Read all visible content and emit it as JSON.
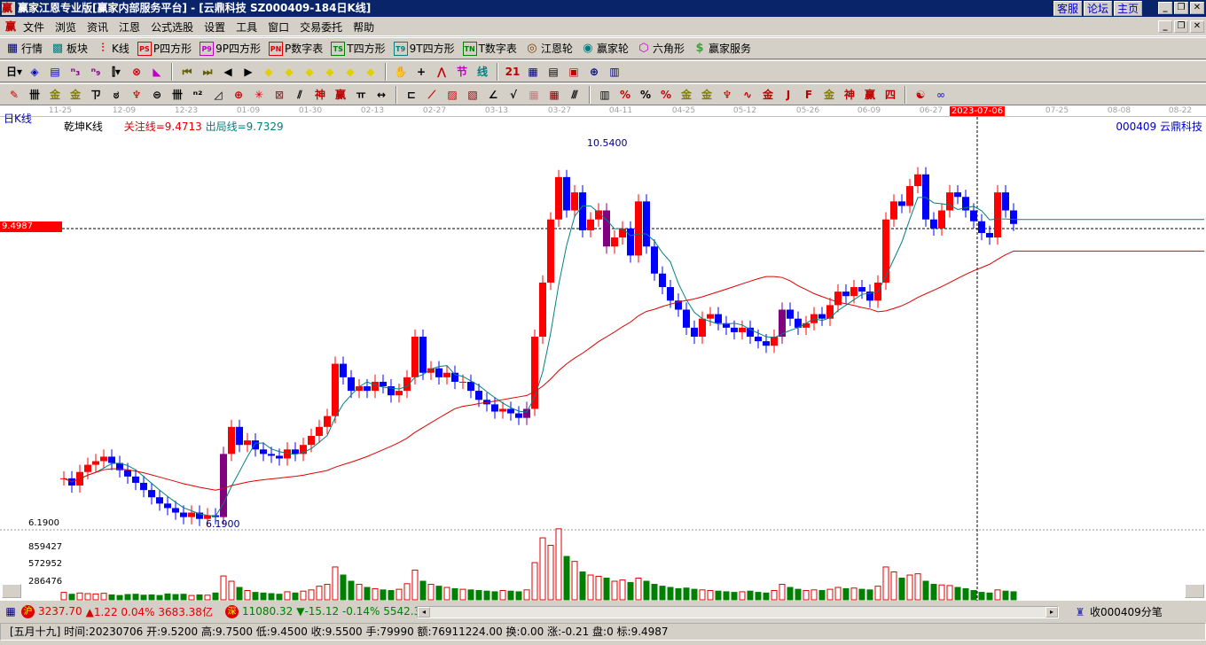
{
  "window": {
    "title": "赢家江恩专业版[赢家内部服务平台] - [云鼎科技   SZ000409-184日K线]",
    "links": [
      "客服",
      "论坛",
      "主页"
    ]
  },
  "menu": [
    "文件",
    "浏览",
    "资讯",
    "江恩",
    "公式选股",
    "设置",
    "工具",
    "窗口",
    "交易委托",
    "帮助"
  ],
  "toolbar1": [
    {
      "icon": "table-icon",
      "glyph": "▦",
      "color": "#000080",
      "label": "行情"
    },
    {
      "icon": "blocks-icon",
      "glyph": "▩",
      "color": "#008080",
      "label": "板块"
    },
    {
      "icon": "kline-icon",
      "glyph": "⫶",
      "color": "#e00000",
      "label": "K线"
    },
    {
      "icon": "ps-icon",
      "glyph": "PS",
      "color": "#e00000",
      "label": "P四方形"
    },
    {
      "icon": "p9-icon",
      "glyph": "P9",
      "color": "#c000c0",
      "label": "9P四方形"
    },
    {
      "icon": "pn-icon",
      "glyph": "PN",
      "color": "#e00000",
      "label": "P数字表"
    },
    {
      "icon": "ts-icon",
      "glyph": "TS",
      "color": "#008000",
      "label": "T四方形"
    },
    {
      "icon": "t9-icon",
      "glyph": "T9",
      "color": "#008080",
      "label": "9T四方形"
    },
    {
      "icon": "tn-icon",
      "glyph": "TN",
      "color": "#008000",
      "label": "T数字表"
    },
    {
      "icon": "gann-wheel-icon",
      "glyph": "◎",
      "color": "#804000",
      "label": "江恩轮"
    },
    {
      "icon": "winner-wheel-icon",
      "glyph": "◉",
      "color": "#008080",
      "label": "赢家轮"
    },
    {
      "icon": "hexagon-icon",
      "glyph": "⬡",
      "color": "#c000c0",
      "label": "六角形"
    },
    {
      "icon": "dollar-icon",
      "glyph": "$",
      "color": "#40a040",
      "label": "赢家服务"
    }
  ],
  "toolbar2": [
    {
      "n": "period-day",
      "g": "日▾",
      "c": "#000"
    },
    {
      "n": "chart-style",
      "g": "◈",
      "c": "#0000c0"
    },
    {
      "n": "notes",
      "g": "▤",
      "c": "#0000c0"
    },
    {
      "n": "indicator-3",
      "g": "ⁿ₃",
      "c": "#800080"
    },
    {
      "n": "indicator-9",
      "g": "ⁿ₉",
      "c": "#800080"
    },
    {
      "n": "candle-type",
      "g": "⫿▾",
      "c": "#000"
    },
    {
      "n": "restore",
      "g": "⊗",
      "c": "#c00000"
    },
    {
      "n": "flag",
      "g": "◣",
      "c": "#c000c0"
    },
    {
      "n": "first",
      "g": "⏮",
      "c": "#606000"
    },
    {
      "n": "last",
      "g": "⏭",
      "c": "#606000"
    },
    {
      "n": "prev",
      "g": "◀",
      "c": "#000"
    },
    {
      "n": "next",
      "g": "▶",
      "c": "#000"
    },
    {
      "n": "diamond-left",
      "g": "◆",
      "c": "#e0d000"
    },
    {
      "n": "diamond-right",
      "g": "◆",
      "c": "#e0d000"
    },
    {
      "n": "diamond-h",
      "g": "◆",
      "c": "#e0d000"
    },
    {
      "n": "diamond-x",
      "g": "◆",
      "c": "#e0d000"
    },
    {
      "n": "diamond-star",
      "g": "◆",
      "c": "#e0d000"
    },
    {
      "n": "diamond-cross",
      "g": "◆",
      "c": "#e0d000"
    },
    {
      "n": "hand",
      "g": "✋",
      "c": "#000"
    },
    {
      "n": "crosshair",
      "g": "+",
      "c": "#000"
    },
    {
      "n": "zigzag",
      "g": "⋀",
      "c": "#c00000"
    },
    {
      "n": "section",
      "g": "节",
      "c": "#c000c0"
    },
    {
      "n": "line-draw",
      "g": "线",
      "c": "#008080"
    },
    {
      "n": "calendar",
      "g": "21",
      "c": "#c00000"
    },
    {
      "n": "calculator",
      "g": "▦",
      "c": "#000080"
    },
    {
      "n": "report",
      "g": "▤",
      "c": "#000"
    },
    {
      "n": "save",
      "g": "▣",
      "c": "#c00000"
    },
    {
      "n": "network",
      "g": "⊕",
      "c": "#000080"
    },
    {
      "n": "print",
      "g": "▥",
      "c": "#000080"
    }
  ],
  "toolbar3": [
    {
      "n": "pen",
      "g": "✎",
      "c": "#c00000"
    },
    {
      "n": "grid-lines",
      "g": "卌",
      "c": "#000"
    },
    {
      "n": "gold-1",
      "g": "金",
      "c": "#808000"
    },
    {
      "n": "gold-2",
      "g": "金",
      "c": "#808000"
    },
    {
      "n": "f-lines",
      "g": "ㄗ",
      "c": "#000"
    },
    {
      "n": "spiral",
      "g": "ಠ",
      "c": "#000"
    },
    {
      "n": "rocket",
      "g": "♆",
      "c": "#c00000"
    },
    {
      "n": "circle-h",
      "g": "⊜",
      "c": "#000"
    },
    {
      "n": "bars",
      "g": "卌",
      "c": "#000"
    },
    {
      "n": "n2",
      "g": "ⁿ²",
      "c": "#000"
    },
    {
      "n": "triangle",
      "g": "◿",
      "c": "#000"
    },
    {
      "n": "target",
      "g": "⊕",
      "c": "#c00000"
    },
    {
      "n": "asterisk",
      "g": "✳",
      "c": "#c00000"
    },
    {
      "n": "square-x",
      "g": "⊠",
      "c": "#804040"
    },
    {
      "n": "slash",
      "g": "⫽",
      "c": "#000"
    },
    {
      "n": "shen",
      "g": "神",
      "c": "#c00000"
    },
    {
      "n": "ying",
      "g": "赢",
      "c": "#c00000"
    },
    {
      "n": "comb",
      "g": "ㅠ",
      "c": "#000"
    },
    {
      "n": "measure",
      "g": "↔",
      "c": "#000"
    },
    {
      "n": "box-line",
      "g": "⊏",
      "c": "#000"
    },
    {
      "n": "fan",
      "g": "⟋",
      "c": "#c00000"
    },
    {
      "n": "box-fan",
      "g": "▨",
      "c": "#c00000"
    },
    {
      "n": "box-fan-2",
      "g": "▧",
      "c": "#800000"
    },
    {
      "n": "angle",
      "g": "∠",
      "c": "#000"
    },
    {
      "n": "vee",
      "g": "√",
      "c": "#000"
    },
    {
      "n": "grid",
      "g": "▦",
      "c": "#c08080"
    },
    {
      "n": "grid-2",
      "g": "▦",
      "c": "#800000"
    },
    {
      "n": "parallel",
      "g": "⫻",
      "c": "#000"
    },
    {
      "n": "bars-2",
      "g": "▥",
      "c": "#000"
    },
    {
      "n": "pct-1",
      "g": "%",
      "c": "#c00000"
    },
    {
      "n": "pct-2",
      "g": "%",
      "c": "#000"
    },
    {
      "n": "pct-3",
      "g": "%",
      "c": "#c00000"
    },
    {
      "n": "gold-circle",
      "g": "金",
      "c": "#808000"
    },
    {
      "n": "gold-3",
      "g": "金",
      "c": "#808000"
    },
    {
      "n": "rocket-2",
      "g": "♆",
      "c": "#c00000"
    },
    {
      "n": "wave",
      "g": "∿",
      "c": "#c00000"
    },
    {
      "n": "gold-4",
      "g": "金",
      "c": "#c00000"
    },
    {
      "n": "j-angle",
      "g": "J",
      "c": "#c00000"
    },
    {
      "n": "f-angle",
      "g": "F",
      "c": "#c00000"
    },
    {
      "n": "gold-angle",
      "g": "金",
      "c": "#808000"
    },
    {
      "n": "shen-angle",
      "g": "神",
      "c": "#c00000"
    },
    {
      "n": "ying-angle",
      "g": "赢",
      "c": "#c00000"
    },
    {
      "n": "si-angle",
      "g": "四",
      "c": "#c00000"
    },
    {
      "n": "yinyang",
      "g": "☯",
      "c": "#c00000"
    },
    {
      "n": "infinity",
      "g": "∞",
      "c": "#4040c0"
    }
  ],
  "chart": {
    "period": "日K线",
    "indicator": "乾坤K线",
    "focus_line": "关注线=9.4713",
    "exit_line": "出局线=9.7329",
    "code": "000409  云鼎科技",
    "price_tag": "9.4987",
    "high_label": "10.5400",
    "low_label": "6.1900",
    "low_mark": "6.1900",
    "vol_labels": [
      "859427",
      "572952",
      "286476"
    ],
    "dates": [
      "11-25",
      "12-09",
      "12-23",
      "01-09",
      "01-30",
      "02-13",
      "02-27",
      "03-13",
      "03-27",
      "04-11",
      "04-25",
      "05-12",
      "05-26",
      "06-09",
      "06-27",
      "2023-07-06",
      "07-25",
      "08-08",
      "08-22"
    ],
    "selected_date": "2023-07-06"
  },
  "chart_data": {
    "type": "candlestick",
    "ylim": [
      6.19,
      10.54
    ],
    "reference_price": 9.4987,
    "ma_periods": [
      5,
      30
    ],
    "close": [
      6.73,
      6.65,
      6.8,
      6.88,
      6.92,
      6.97,
      6.9,
      6.82,
      6.75,
      6.68,
      6.6,
      6.52,
      6.45,
      6.4,
      6.35,
      6.3,
      6.35,
      6.28,
      6.32,
      6.3,
      7.0,
      7.3,
      7.1,
      7.15,
      7.05,
      7.0,
      6.98,
      6.95,
      7.05,
      7.0,
      7.1,
      7.2,
      7.3,
      7.42,
      8.0,
      7.85,
      7.7,
      7.75,
      7.7,
      7.8,
      7.75,
      7.65,
      7.7,
      7.85,
      8.3,
      7.9,
      7.95,
      7.85,
      7.9,
      7.8,
      7.8,
      7.7,
      7.6,
      7.55,
      7.47,
      7.5,
      7.45,
      7.4,
      7.5,
      8.3,
      8.9,
      9.6,
      10.07,
      9.7,
      9.9,
      9.48,
      9.6,
      9.7,
      9.3,
      9.4,
      9.5,
      9.2,
      9.8,
      9.3,
      9.0,
      8.85,
      8.7,
      8.6,
      8.4,
      8.3,
      8.5,
      8.55,
      8.45,
      8.4,
      8.35,
      8.4,
      8.3,
      8.25,
      8.2,
      8.3,
      8.6,
      8.5,
      8.4,
      8.45,
      8.55,
      8.5,
      8.65,
      8.8,
      8.75,
      8.85,
      8.8,
      8.7,
      8.9,
      9.6,
      9.8,
      9.75,
      9.97,
      10.1,
      9.6,
      9.5,
      9.7,
      9.9,
      9.85,
      9.7,
      9.58,
      9.45,
      9.4,
      9.9,
      9.7,
      9.55
    ],
    "volume_k": [
      120,
      90,
      110,
      100,
      95,
      105,
      80,
      70,
      85,
      90,
      75,
      80,
      70,
      95,
      85,
      90,
      70,
      80,
      75,
      110,
      385,
      300,
      200,
      150,
      120,
      110,
      100,
      90,
      130,
      110,
      140,
      160,
      220,
      250,
      530,
      400,
      300,
      250,
      200,
      180,
      160,
      150,
      170,
      260,
      480,
      300,
      250,
      220,
      200,
      180,
      170,
      160,
      150,
      140,
      130,
      150,
      140,
      130,
      160,
      600,
      1000,
      880,
      1146,
      700,
      620,
      450,
      400,
      380,
      350,
      300,
      320,
      280,
      350,
      300,
      250,
      220,
      200,
      180,
      190,
      170,
      160,
      150,
      140,
      130,
      120,
      130,
      140,
      120,
      110,
      150,
      250,
      200,
      170,
      150,
      160,
      150,
      170,
      200,
      180,
      190,
      170,
      160,
      220,
      530,
      450,
      350,
      400,
      420,
      300,
      250,
      240,
      230,
      200,
      180,
      150,
      120,
      110,
      160,
      140,
      130
    ]
  },
  "index_bar": {
    "sh_label": "沪",
    "sh_value": "3237.70",
    "sh_change": "▲1.22 0.04% 3683.38亿",
    "sz_label": "深",
    "sz_value": "11080.32",
    "sz_change": "▼-15.12 -0.14% 5542.3",
    "receive": "收000409分笔"
  },
  "status": "[五月十九] 时间:20230706 开:9.5200 高:9.7500 低:9.4500 收:9.5500 手:79990 额:76911224.00 换:0.00 涨:-0.21 盘:0 标:9.4987"
}
